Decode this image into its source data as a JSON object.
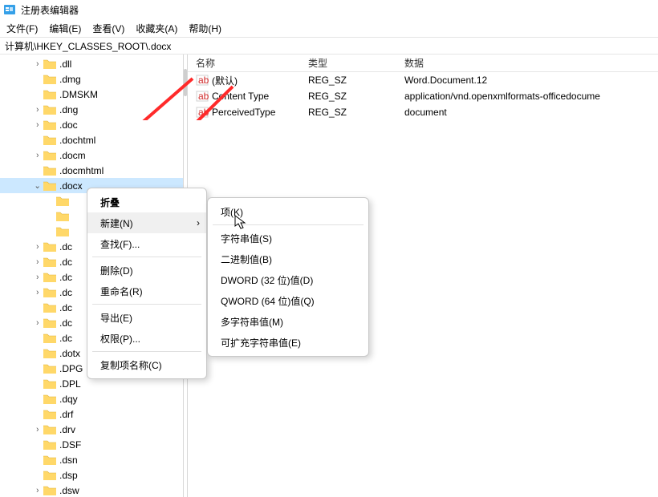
{
  "window": {
    "title": "注册表编辑器"
  },
  "menubar": {
    "file": "文件(F)",
    "edit": "编辑(E)",
    "view": "查看(V)",
    "fav": "收藏夹(A)",
    "help": "帮助(H)"
  },
  "address": "计算机\\HKEY_CLASSES_ROOT\\.docx",
  "tree": {
    "items": [
      {
        "depth": 2,
        "exp": ">",
        "label": ".dll"
      },
      {
        "depth": 2,
        "exp": "",
        "label": ".dmg"
      },
      {
        "depth": 2,
        "exp": "",
        "label": ".DMSKM"
      },
      {
        "depth": 2,
        "exp": ">",
        "label": ".dng"
      },
      {
        "depth": 2,
        "exp": ">",
        "label": ".doc"
      },
      {
        "depth": 2,
        "exp": "",
        "label": ".dochtml"
      },
      {
        "depth": 2,
        "exp": ">",
        "label": ".docm"
      },
      {
        "depth": 2,
        "exp": "",
        "label": ".docmhtml"
      },
      {
        "depth": 2,
        "exp": "v",
        "label": ".docx",
        "sel": true
      },
      {
        "depth": 3,
        "exp": "",
        "label": ""
      },
      {
        "depth": 3,
        "exp": "",
        "label": ""
      },
      {
        "depth": 3,
        "exp": "",
        "label": ""
      },
      {
        "depth": 2,
        "exp": ">",
        "label": ".dc"
      },
      {
        "depth": 2,
        "exp": ">",
        "label": ".dc"
      },
      {
        "depth": 2,
        "exp": ">",
        "label": ".dc"
      },
      {
        "depth": 2,
        "exp": ">",
        "label": ".dc"
      },
      {
        "depth": 2,
        "exp": "",
        "label": ".dc"
      },
      {
        "depth": 2,
        "exp": ">",
        "label": ".dc"
      },
      {
        "depth": 2,
        "exp": "",
        "label": ".dc"
      },
      {
        "depth": 2,
        "exp": "",
        "label": ".dotx"
      },
      {
        "depth": 2,
        "exp": "",
        "label": ".DPG"
      },
      {
        "depth": 2,
        "exp": "",
        "label": ".DPL"
      },
      {
        "depth": 2,
        "exp": "",
        "label": ".dqy"
      },
      {
        "depth": 2,
        "exp": "",
        "label": ".drf"
      },
      {
        "depth": 2,
        "exp": ">",
        "label": ".drv"
      },
      {
        "depth": 2,
        "exp": "",
        "label": ".DSF"
      },
      {
        "depth": 2,
        "exp": "",
        "label": ".dsn"
      },
      {
        "depth": 2,
        "exp": "",
        "label": ".dsp"
      },
      {
        "depth": 2,
        "exp": ">",
        "label": ".dsw"
      }
    ]
  },
  "values": {
    "headers": {
      "name": "名称",
      "type": "类型",
      "data": "数据"
    },
    "rows": [
      {
        "name": "(默认)",
        "type": "REG_SZ",
        "data": "Word.Document.12"
      },
      {
        "name": "Content Type",
        "type": "REG_SZ",
        "data": "application/vnd.openxmlformats-officedocume"
      },
      {
        "name": "PerceivedType",
        "type": "REG_SZ",
        "data": "document"
      }
    ]
  },
  "context_menu": {
    "collapse": "折叠",
    "new": "新建(N)",
    "find": "查找(F)...",
    "delete": "删除(D)",
    "rename": "重命名(R)",
    "export": "导出(E)",
    "perm": "权限(P)...",
    "copykey": "复制项名称(C)"
  },
  "submenu": {
    "key": "项(K)",
    "string": "字符串值(S)",
    "binary": "二进制值(B)",
    "dword": "DWORD (32 位)值(D)",
    "qword": "QWORD (64 位)值(Q)",
    "multi": "多字符串值(M)",
    "expand": "可扩充字符串值(E)"
  },
  "colors": {
    "accent_arrow": "#ff2a2a"
  }
}
